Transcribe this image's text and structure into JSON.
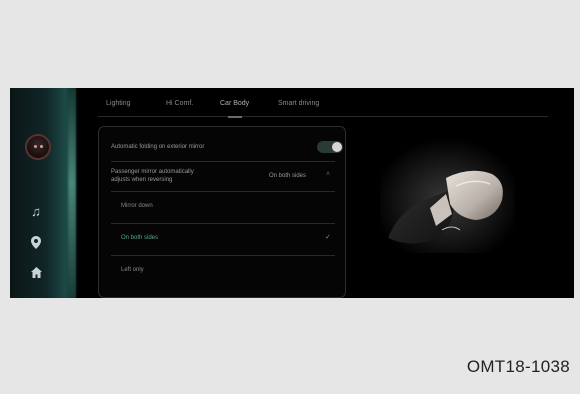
{
  "tabs": [
    {
      "label": "Lighting",
      "active": false
    },
    {
      "label": "Hi Comf.",
      "active": false
    },
    {
      "label": "Car Body",
      "active": true
    },
    {
      "label": "Smart driving",
      "active": false
    }
  ],
  "sidebar": {
    "icons": [
      "avatar-icon",
      "music-icon",
      "location-icon",
      "home-icon"
    ]
  },
  "settings": {
    "auto_folding_label": "Automatic folding on exterior mirror",
    "auto_folding_enabled": true,
    "reverse_mirror_label_line1": "Passenger mirror automatically",
    "reverse_mirror_label_line2": "adjusts when reversing",
    "reverse_mirror_value": "On both sides",
    "options": [
      {
        "label": "Mirror down",
        "selected": false
      },
      {
        "label": "On both sides",
        "selected": true
      },
      {
        "label": "Left only",
        "selected": false
      }
    ]
  },
  "caption": "OMT18-1038",
  "colors": {
    "accent": "#5aa58e",
    "screen_bg": "#000000",
    "page_bg": "#e6e6e6"
  }
}
